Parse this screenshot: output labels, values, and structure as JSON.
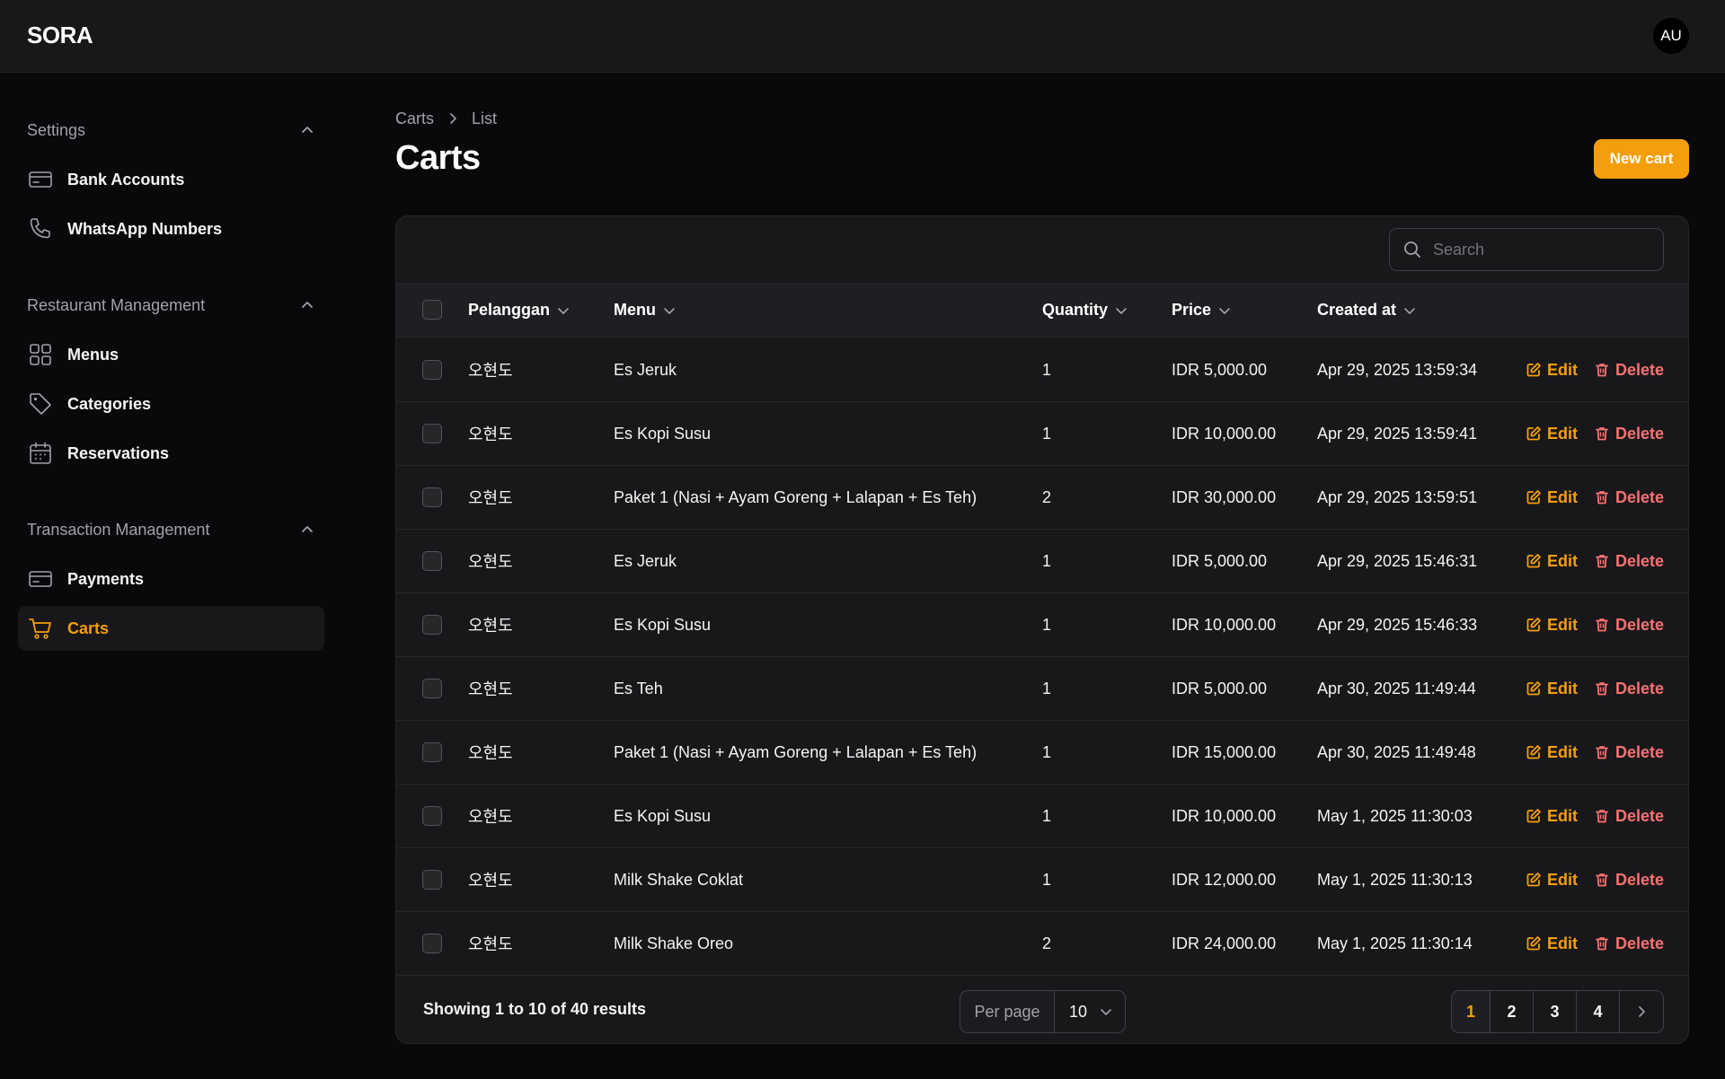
{
  "app": {
    "brand": "SORA",
    "avatar_initials": "AU"
  },
  "sidebar": {
    "groups": [
      {
        "label": "Settings",
        "items": [
          {
            "label": "Bank Accounts",
            "icon": "credit-card-icon"
          },
          {
            "label": "WhatsApp Numbers",
            "icon": "phone-icon"
          }
        ]
      },
      {
        "label": "Restaurant Management",
        "items": [
          {
            "label": "Menus",
            "icon": "grid-icon"
          },
          {
            "label": "Categories",
            "icon": "tag-icon"
          },
          {
            "label": "Reservations",
            "icon": "calendar-icon"
          }
        ]
      },
      {
        "label": "Transaction Management",
        "items": [
          {
            "label": "Payments",
            "icon": "credit-card-icon"
          },
          {
            "label": "Carts",
            "icon": "shopping-cart-icon",
            "active": true
          }
        ]
      }
    ]
  },
  "breadcrumb": {
    "parent": "Carts",
    "current": "List"
  },
  "page": {
    "title": "Carts",
    "new_button": "New cart"
  },
  "search": {
    "placeholder": "Search"
  },
  "table": {
    "columns": {
      "customer": "Pelanggan",
      "menu": "Menu",
      "quantity": "Quantity",
      "price": "Price",
      "created": "Created at"
    },
    "actions": {
      "edit": "Edit",
      "delete": "Delete"
    },
    "rows": [
      {
        "customer": "오현도",
        "menu": "Es Jeruk",
        "quantity": "1",
        "price": "IDR 5,000.00",
        "created": "Apr 29, 2025 13:59:34"
      },
      {
        "customer": "오현도",
        "menu": "Es Kopi Susu",
        "quantity": "1",
        "price": "IDR 10,000.00",
        "created": "Apr 29, 2025 13:59:41"
      },
      {
        "customer": "오현도",
        "menu": "Paket 1 (Nasi + Ayam Goreng + Lalapan + Es Teh)",
        "quantity": "2",
        "price": "IDR 30,000.00",
        "created": "Apr 29, 2025 13:59:51"
      },
      {
        "customer": "오현도",
        "menu": "Es Jeruk",
        "quantity": "1",
        "price": "IDR 5,000.00",
        "created": "Apr 29, 2025 15:46:31"
      },
      {
        "customer": "오현도",
        "menu": "Es Kopi Susu",
        "quantity": "1",
        "price": "IDR 10,000.00",
        "created": "Apr 29, 2025 15:46:33"
      },
      {
        "customer": "오현도",
        "menu": "Es Teh",
        "quantity": "1",
        "price": "IDR 5,000.00",
        "created": "Apr 30, 2025 11:49:44"
      },
      {
        "customer": "오현도",
        "menu": "Paket 1 (Nasi + Ayam Goreng + Lalapan + Es Teh)",
        "quantity": "1",
        "price": "IDR 15,000.00",
        "created": "Apr 30, 2025 11:49:48"
      },
      {
        "customer": "오현도",
        "menu": "Es Kopi Susu",
        "quantity": "1",
        "price": "IDR 10,000.00",
        "created": "May 1, 2025 11:30:03"
      },
      {
        "customer": "오현도",
        "menu": "Milk Shake Coklat",
        "quantity": "1",
        "price": "IDR 12,000.00",
        "created": "May 1, 2025 11:30:13"
      },
      {
        "customer": "오현도",
        "menu": "Milk Shake Oreo",
        "quantity": "2",
        "price": "IDR 24,000.00",
        "created": "May 1, 2025 11:30:14"
      }
    ]
  },
  "footer": {
    "summary": "Showing 1 to 10 of 40 results",
    "per_page_label": "Per page",
    "per_page_value": "10",
    "pages": [
      "1",
      "2",
      "3",
      "4"
    ],
    "current_page": "1"
  },
  "colors": {
    "accent": "#f59e0b",
    "danger": "#f87171",
    "background": "#09090b",
    "surface": "#18181b"
  }
}
